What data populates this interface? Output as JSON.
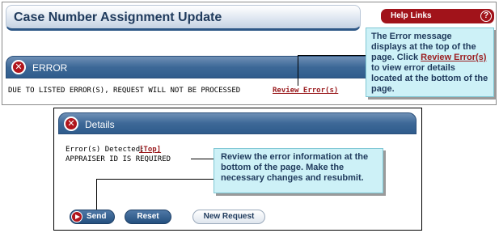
{
  "top_panel": {
    "page_title": "Case Number Assignment Update",
    "help_links_label": "Help Links",
    "help_icon_glyph": "?",
    "error_header": "ERROR",
    "error_message": "DUE TO LISTED ERROR(S), REQUEST WILL NOT BE PROCESSED",
    "review_link": "Review Error(s)"
  },
  "callout_top": {
    "line1": "The Error message displays at the top of the page.  Click ",
    "link": "Review Error(s)",
    "line2": " to view error details located at the bottom of the page."
  },
  "bottom_panel": {
    "details_header": "Details",
    "errors_detected_label": "Error(s) Detected:",
    "top_link": "[Top]",
    "error_item": "APPRAISER ID IS REQUIRED",
    "buttons": {
      "send": "Send",
      "reset": "Reset",
      "new_request": "New Request"
    }
  },
  "callout_bottom": {
    "text": "Review the error information at the bottom of the page.  Make the necessary changes and resubmit."
  },
  "colors": {
    "header_blue": "#3d6897",
    "error_red": "#b0161d",
    "callout_bg": "#cdf1f7",
    "link_red": "#9b1d20"
  },
  "icons": {
    "error": "error-x-icon",
    "send": "play-circle-icon"
  }
}
